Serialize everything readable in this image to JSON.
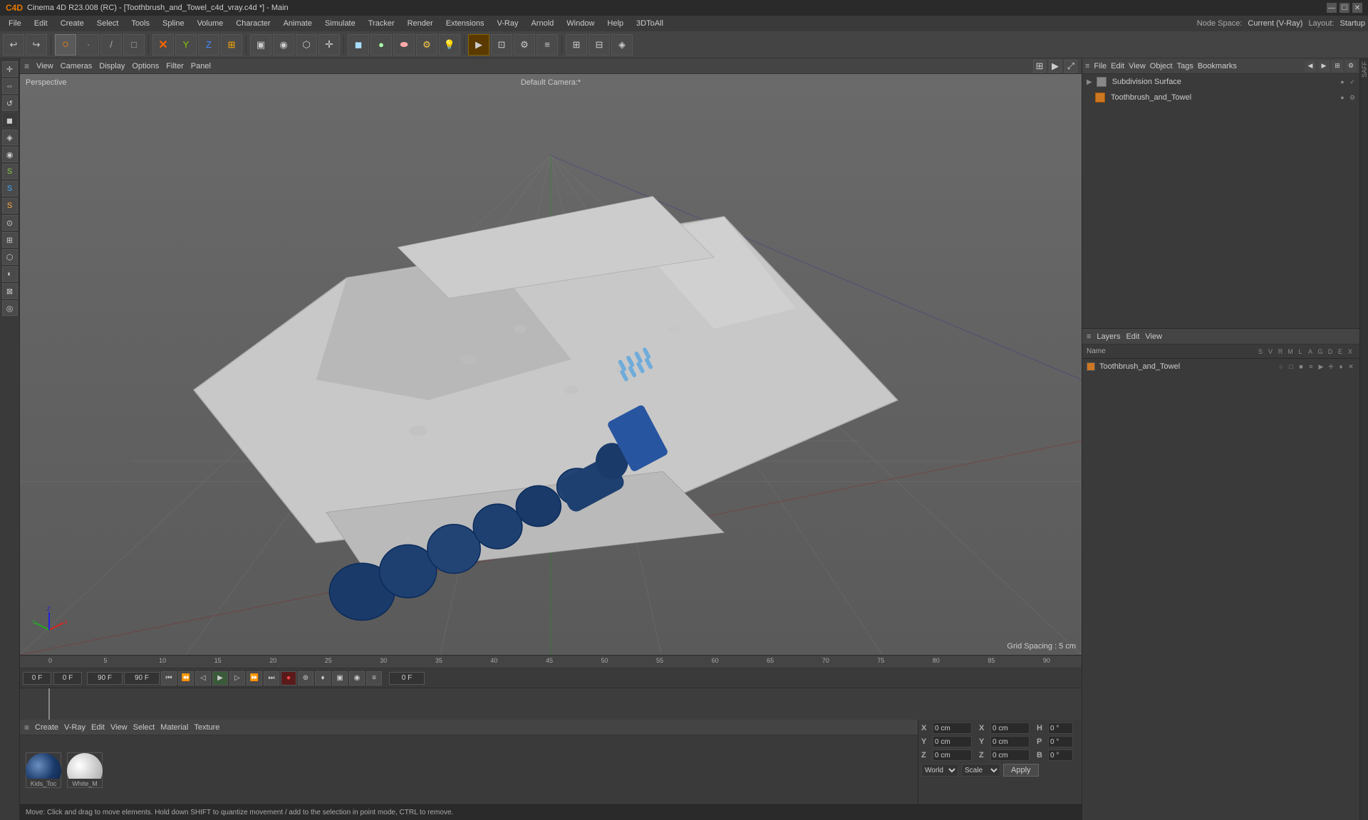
{
  "app": {
    "title": "Cinema 4D R23.008 (RC) - [Toothbrush_and_Towel_c4d_vray.c4d *] - Main"
  },
  "titlebar": {
    "title": "Cinema 4D R23.008 (RC) - [Toothbrush_and_Towel_c4d_vray.c4d *] - Main",
    "btns": [
      "—",
      "☐",
      "✕"
    ]
  },
  "menubar": {
    "items": [
      "File",
      "Edit",
      "Create",
      "Select",
      "Tools",
      "Spline",
      "Volume",
      "Character",
      "Animate",
      "Simulate",
      "Tracker",
      "Render",
      "Extensions",
      "V-Ray",
      "Arnold",
      "Window",
      "Help",
      "3DToAll"
    ],
    "right": {
      "node_space_label": "Node Space:",
      "node_space_value": "Current (V-Ray)",
      "layout_label": "Layout:",
      "layout_value": "Startup"
    }
  },
  "toolbar": {
    "groups": [
      {
        "label": "undo",
        "icon": "↩"
      },
      {
        "label": "redo",
        "icon": "↪"
      },
      {
        "label": "modes",
        "icon": "⊞"
      },
      {
        "label": "select",
        "icon": "▶"
      },
      {
        "label": "move",
        "icon": "✛"
      },
      {
        "label": "rotate",
        "icon": "↺"
      },
      {
        "label": "scale",
        "icon": "⇔"
      },
      {
        "label": "render",
        "icon": "▶"
      },
      {
        "label": "camera",
        "icon": "📷"
      }
    ]
  },
  "viewport": {
    "label_perspective": "Perspective",
    "label_camera": "Default Camera:*",
    "grid_spacing": "Grid Spacing : 5 cm",
    "menus": [
      "View",
      "Cameras",
      "Display",
      "Options",
      "Filter",
      "Panel"
    ]
  },
  "timeline": {
    "start": "0 F",
    "end": "90 F",
    "current": "0 F",
    "playback_end": "90 F",
    "frame_input1": "0 F",
    "frame_input2": "0 F",
    "ticks": [
      "0",
      "5",
      "10",
      "15",
      "20",
      "25",
      "30",
      "35",
      "40",
      "45",
      "50",
      "55",
      "60",
      "65",
      "70",
      "75",
      "80",
      "85",
      "90"
    ]
  },
  "material_panel": {
    "menus": [
      "Create",
      "V-Ray",
      "Edit",
      "View",
      "Select",
      "Material",
      "Texture"
    ],
    "materials": [
      {
        "name": "Kids_Toc",
        "color1": "#4a6fa5",
        "color2": "#2a4a7a"
      },
      {
        "name": "White_M",
        "color1": "#d0d0d0",
        "color2": "#b0b0b0"
      }
    ]
  },
  "coords": {
    "x_pos": "0 cm",
    "y_pos": "0 cm",
    "z_pos": "0 cm",
    "x_scale": "0 cm",
    "y_scale": "0 cm",
    "z_scale": "0 cm",
    "h": "0 °",
    "p": "0 °",
    "b": "0 °",
    "transform_space": "World",
    "transform_type": "Scale",
    "apply_label": "Apply"
  },
  "object_manager": {
    "menus": [
      "File",
      "Edit",
      "View",
      "Object",
      "Tags",
      "Bookmarks"
    ],
    "objects": [
      {
        "name": "Subdivision Surface",
        "indent": 0,
        "color": "#888888",
        "enabled": true
      },
      {
        "name": "Toothbrush_and_Towel",
        "indent": 1,
        "color": "#cc7722",
        "enabled": true
      }
    ]
  },
  "layer_manager": {
    "menus": [
      "Layers",
      "Edit",
      "View"
    ],
    "header_cols": [
      "Name",
      "S",
      "V",
      "R",
      "M",
      "L",
      "A",
      "G",
      "D",
      "E",
      "X"
    ],
    "layers": [
      {
        "name": "Toothbrush_and_Towel",
        "color": "#cc7722"
      }
    ]
  },
  "statusbar": {
    "text": "Move: Click and drag to move elements. Hold down SHIFT to quantize movement / add to the selection in point mode, CTRL to remove."
  },
  "colors": {
    "accent_orange": "#cc7722",
    "accent_blue": "#4a6fa5",
    "bg_dark": "#2a2a2a",
    "bg_mid": "#3a3a3a",
    "bg_light": "#4a4a4a",
    "border": "#555555"
  }
}
